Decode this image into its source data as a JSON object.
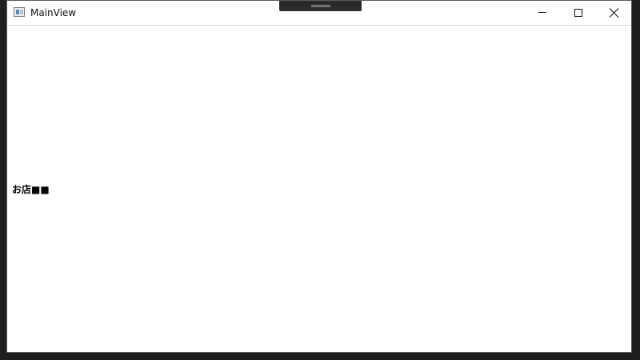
{
  "window": {
    "title": "MainView"
  },
  "titlebar": {
    "icons": {
      "app": "application-icon",
      "minimize": "minimize-icon",
      "maximize": "maximize-icon",
      "close": "close-icon"
    }
  },
  "content": {
    "label": "お店■■"
  }
}
